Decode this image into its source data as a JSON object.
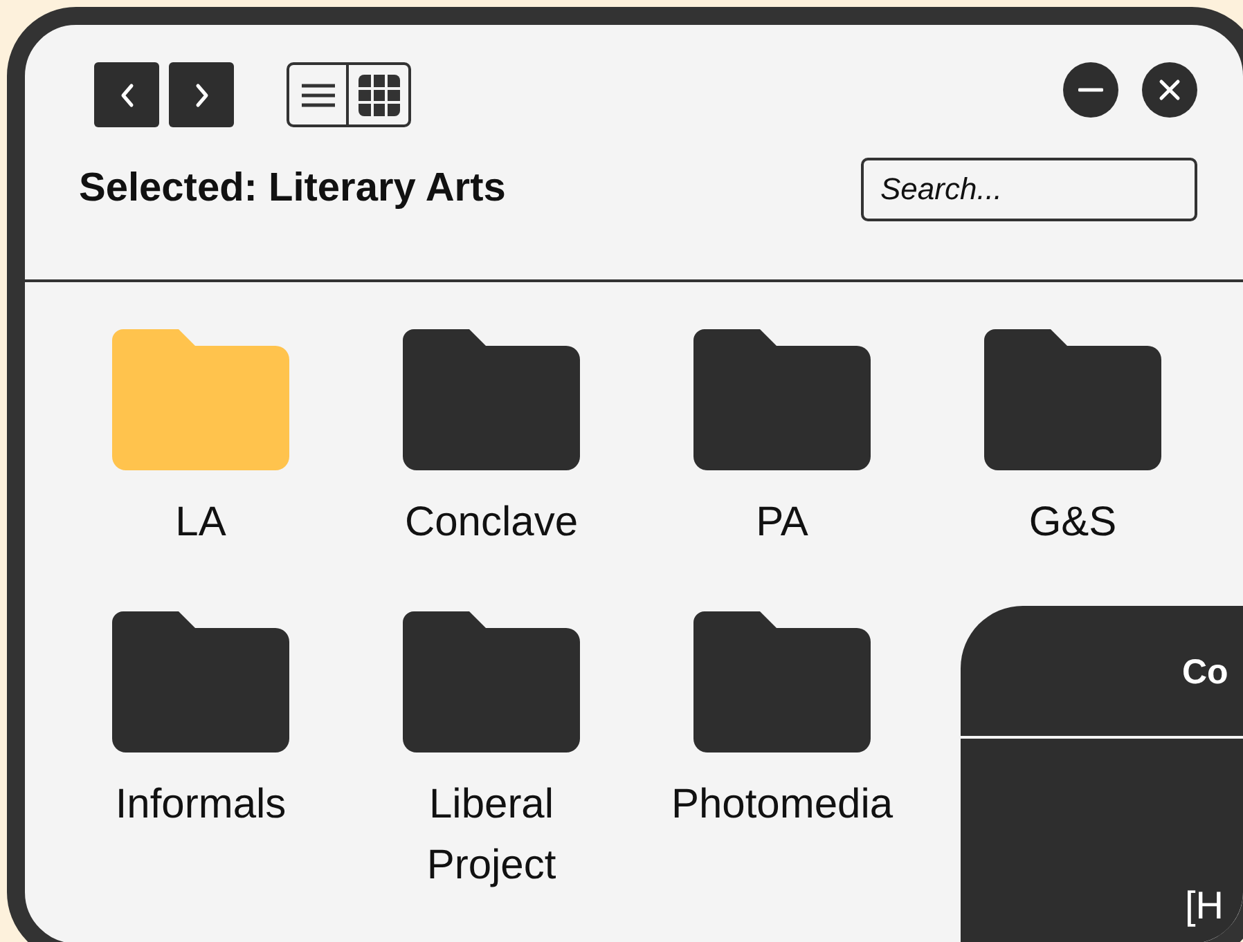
{
  "window": {
    "title": "Selected: Literary Arts"
  },
  "search": {
    "placeholder": "Search..."
  },
  "folders": [
    {
      "label": "LA",
      "selected": true
    },
    {
      "label": "Conclave",
      "selected": false
    },
    {
      "label": "PA",
      "selected": false
    },
    {
      "label": "G&S",
      "selected": false
    },
    {
      "label": "Informals",
      "selected": false
    },
    {
      "label": "Liberal Project",
      "selected": false
    },
    {
      "label": "Photomedia",
      "selected": false
    }
  ],
  "panel": {
    "title": "Co",
    "text": "[H"
  }
}
